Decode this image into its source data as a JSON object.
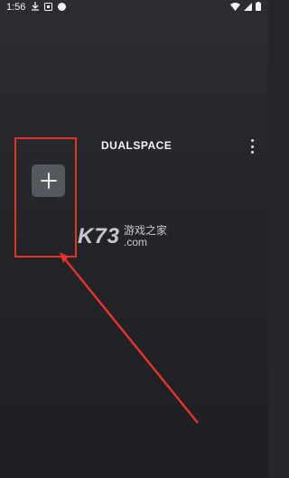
{
  "status": {
    "time": "1:56",
    "left_icons": [
      "download-icon",
      "notification-icon",
      "circle-icon"
    ],
    "right_icons": [
      "wifi-icon",
      "signal-icon",
      "battery-icon"
    ]
  },
  "app": {
    "brand": "DUALSPACE",
    "menu_icon": "more-vert-icon",
    "add_icon": "plus-icon",
    "accent": "#e5322a"
  },
  "watermark": {
    "logo": "K73",
    "line1": "游戏之家",
    "line2": ".com"
  }
}
